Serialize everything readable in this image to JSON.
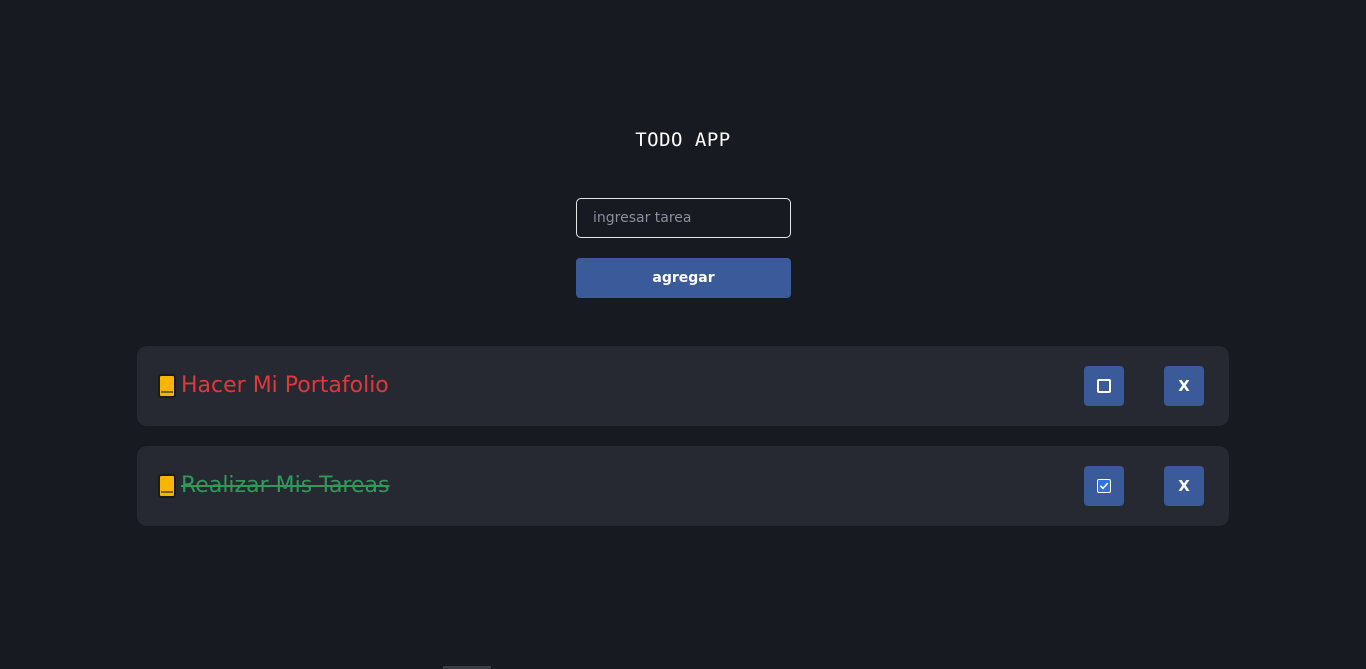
{
  "app": {
    "title": "TODO APP"
  },
  "form": {
    "input_placeholder": "ingresar tarea",
    "input_value": "",
    "add_button_label": "agregar"
  },
  "tasks": [
    {
      "text": "Hacer Mi Portafolio",
      "completed": false,
      "icon": "notebook-icon",
      "delete_label": "X"
    },
    {
      "text": "Realizar Mis Tareas",
      "completed": true,
      "icon": "notebook-icon",
      "delete_label": "X"
    }
  ],
  "colors": {
    "background": "#181a22",
    "card": "#262832",
    "accent": "#3a5a99",
    "pending_text": "#e0393c",
    "completed_text": "#2f9a58"
  }
}
